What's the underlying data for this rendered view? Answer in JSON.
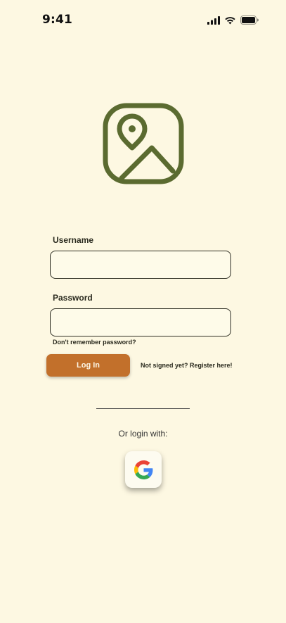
{
  "status_bar": {
    "time": "9:41",
    "icons": [
      "signal-icon",
      "wifi-icon",
      "battery-icon"
    ]
  },
  "logo": {
    "icon": "map-photo-icon",
    "color": "#5b6b30"
  },
  "form": {
    "username_label": "Username",
    "username_value": "",
    "password_label": "Password",
    "password_value": "",
    "forgot_password": "Don't remember password?",
    "login_button": "Log In",
    "register_link": "Not signed yet? Register here!"
  },
  "alternative_login": {
    "label": "Or login with:",
    "providers": [
      "google-icon"
    ]
  },
  "colors": {
    "background": "#fdf8e2",
    "accent": "#c2702b",
    "logo": "#5b6b30"
  }
}
